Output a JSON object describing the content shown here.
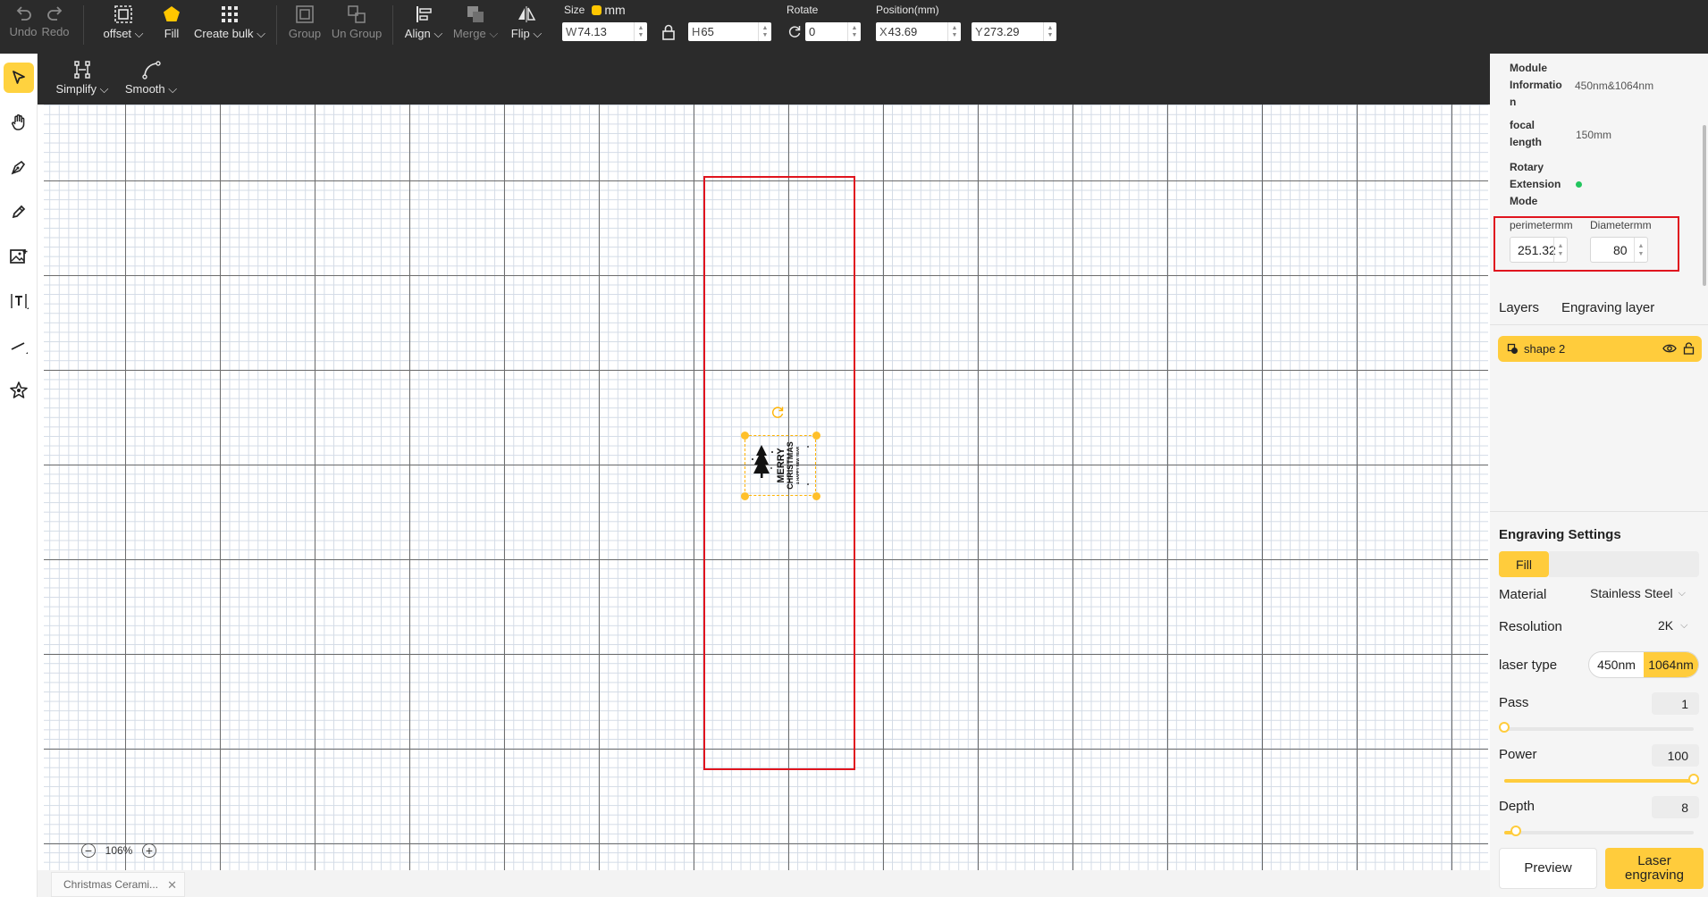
{
  "toolbar": {
    "undo": "Undo",
    "redo": "Redo",
    "offset": "offset",
    "fill": "Fill",
    "create_bulk": "Create bulk",
    "group": "Group",
    "ungroup": "Un Group",
    "align": "Align",
    "merge": "Merge",
    "flip": "Flip",
    "size_label": "Size",
    "size_unit": "mm",
    "w_prefix": "W",
    "w_value": "74.13",
    "h_prefix": "H",
    "h_value": "65",
    "rotate_label": "Rotate",
    "rotate_value": "0",
    "position_label": "Position(mm)",
    "x_prefix": "X",
    "x_value": "43.69",
    "y_prefix": "Y",
    "y_value": "273.29"
  },
  "subtoolbar": {
    "simplify": "Simplify",
    "smooth": "Smooth"
  },
  "left_tools": [
    "select-tool",
    "hand-tool",
    "pen-tool",
    "pencil-tool",
    "image-tool",
    "text-tool",
    "line-tool",
    "shape-tool"
  ],
  "canvas": {
    "zoom": "106%",
    "file_tab": "Christmas Cerami...",
    "artwork": {
      "line1": "MERRY",
      "line2": "CHRISTMAS",
      "line3": "& HAPPY NEW YEAR"
    }
  },
  "module_info": {
    "module_label_1": "Module",
    "module_label_2": "Informatio",
    "module_label_3": "n",
    "module_value": "450nm&1064nm",
    "focal_label_1": "focal",
    "focal_label_2": "length",
    "focal_value": "150mm",
    "rotary_label_1": "Rotary",
    "rotary_label_2": "Extension",
    "rotary_label_3": "Mode",
    "rotary_status_color": "#22c55e"
  },
  "rotary": {
    "perimeter_label": "perimetermm",
    "perimeter_value": "251.32",
    "diameter_label": "Diametermm",
    "diameter_value": "80"
  },
  "tabs": {
    "layers": "Layers",
    "engraving_layer": "Engraving layer"
  },
  "layers": [
    {
      "name": "shape 2"
    }
  ],
  "engraving": {
    "title": "Engraving Settings",
    "mode": "Fill",
    "material_label": "Material",
    "material_value": "Stainless Steel",
    "resolution_label": "Resolution",
    "resolution_value": "2K",
    "laser_type_label": "laser type",
    "laser_options": [
      "450nm",
      "1064nm"
    ],
    "laser_selected": "1064nm",
    "pass_label": "Pass",
    "pass_value": "1",
    "pass_fraction": 0.0,
    "power_label": "Power",
    "power_value": "100",
    "power_fraction": 1.0,
    "depth_label": "Depth",
    "depth_value": "8",
    "depth_fraction": 0.06
  },
  "actions": {
    "preview": "Preview",
    "laser_line1": "Laser",
    "laser_line2": "engraving"
  },
  "colors": {
    "accent": "#ffcc3c",
    "toolbar_bg": "#2b2b2b",
    "workarea_border": "#e0141e"
  }
}
